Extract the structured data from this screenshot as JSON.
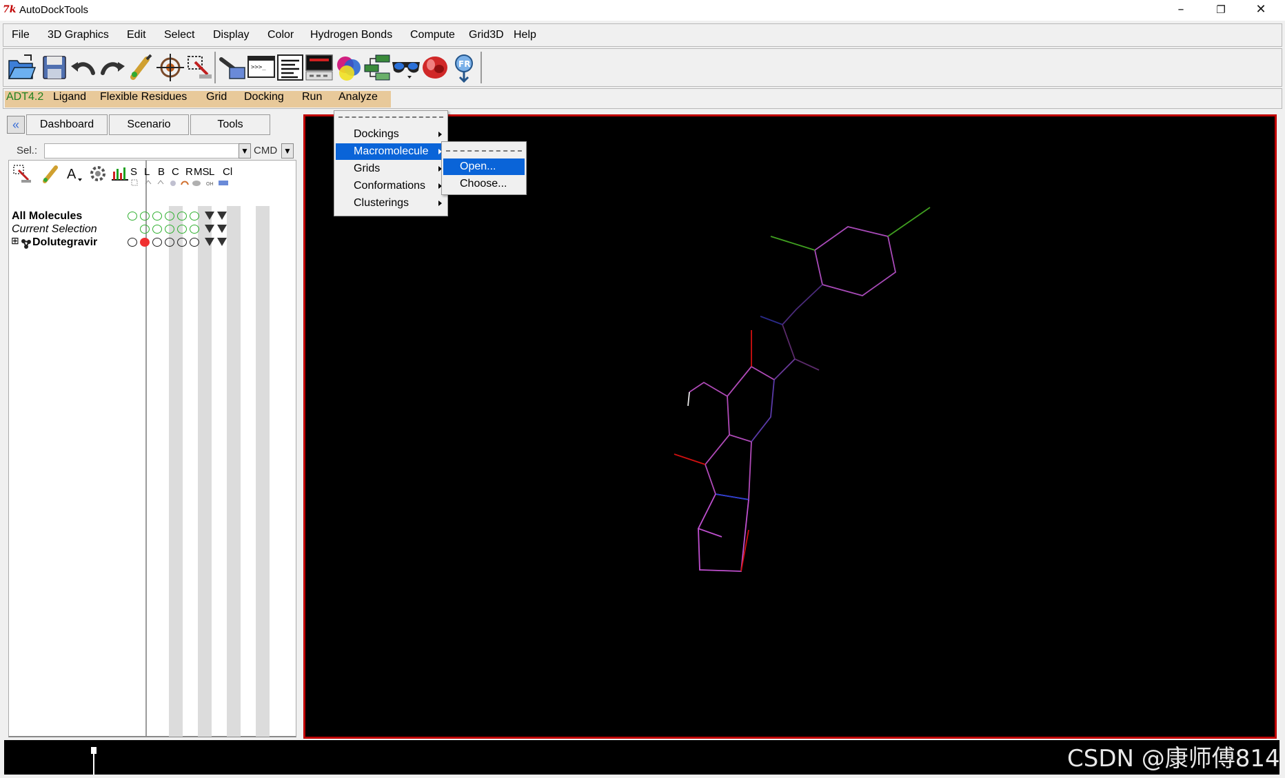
{
  "window": {
    "title": "AutoDockTools",
    "minimize": "–",
    "restore": "❐",
    "close": "✕"
  },
  "menubar": [
    "File",
    "3D Graphics",
    "Edit",
    "Select",
    "Display",
    "Color",
    "Hydrogen Bonds",
    "Compute",
    "Grid3D",
    "Help"
  ],
  "toolbar_icons": [
    "open-icon",
    "save-icon",
    "undo-icon",
    "redo-icon",
    "pick-icon",
    "center-icon",
    "select-icon",
    "python-shell-icon",
    "message-box-icon",
    "text-list-icon",
    "display-icon",
    "color-icon",
    "hierarchy-icon",
    "stereo-glasses-icon",
    "dejavu-icon",
    "info-icon"
  ],
  "adt_tabs": [
    "ADT4.2",
    "Ligand",
    "Flexible Residues",
    "Grid",
    "Docking",
    "Run",
    "Analyze"
  ],
  "nav_tabs": [
    "Dashboard",
    "Scenario",
    "Tools"
  ],
  "selection": {
    "label": "Sel.:",
    "value": "",
    "cmd": "CMD"
  },
  "columns": [
    "S",
    "L",
    "B",
    "C",
    "R",
    "MS",
    "L",
    "Cl"
  ],
  "tree": {
    "all": "All Molecules",
    "current": "Current Selection",
    "expand": "⊞",
    "molecule": "Dolutegravir"
  },
  "analyze_menu": {
    "items": [
      "Dockings",
      "Macromolecule",
      "Grids",
      "Conformations",
      "Clusterings"
    ],
    "selected": "Macromolecule"
  },
  "macromolecule_submenu": {
    "items": [
      "Open...",
      "Choose..."
    ],
    "selected": "Open..."
  },
  "watermark": "CSDN @康师傅814",
  "colors": {
    "viewer_bg": "#000000",
    "viewer_border": "#c00000",
    "menu_highlight": "#0a64d8",
    "adt_tab_bg": "#e8c99a",
    "bond_magenta": "#b050c0",
    "bond_blue": "#2a40d0",
    "bond_red": "#d01010",
    "bond_green": "#40a020"
  }
}
